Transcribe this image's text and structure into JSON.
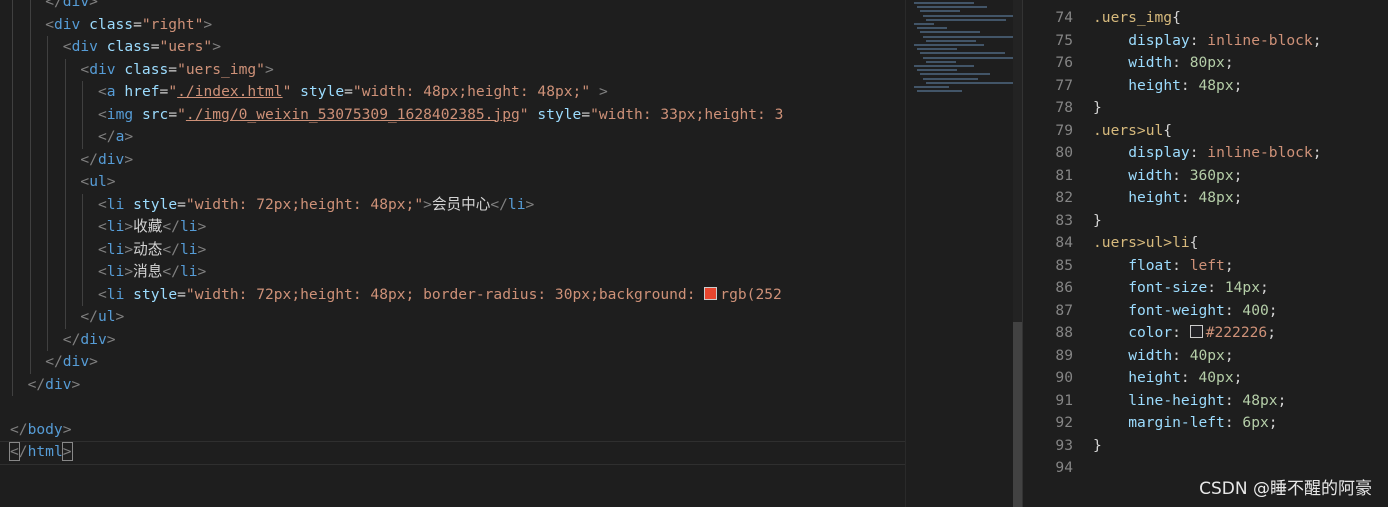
{
  "left_lines": [
    {
      "indent": 4,
      "tokens": [
        [
          "punct",
          "</"
        ],
        [
          "tag",
          "div"
        ],
        [
          "punct",
          ">"
        ]
      ]
    },
    {
      "indent": 4,
      "tokens": [
        [
          "punct",
          "<"
        ],
        [
          "tag",
          "div"
        ],
        [
          "txt",
          " "
        ],
        [
          "attr",
          "class"
        ],
        [
          "txt",
          "="
        ],
        [
          "str",
          "\"right\""
        ],
        [
          "punct",
          ">"
        ]
      ]
    },
    {
      "indent": 6,
      "tokens": [
        [
          "punct",
          "<"
        ],
        [
          "tag",
          "div"
        ],
        [
          "txt",
          " "
        ],
        [
          "attr",
          "class"
        ],
        [
          "txt",
          "="
        ],
        [
          "str",
          "\"uers\""
        ],
        [
          "punct",
          ">"
        ]
      ]
    },
    {
      "indent": 8,
      "tokens": [
        [
          "punct",
          "<"
        ],
        [
          "tag",
          "div"
        ],
        [
          "txt",
          " "
        ],
        [
          "attr",
          "class"
        ],
        [
          "txt",
          "="
        ],
        [
          "str",
          "\"uers_img\""
        ],
        [
          "punct",
          ">"
        ]
      ]
    },
    {
      "indent": 10,
      "tokens": [
        [
          "punct",
          "<"
        ],
        [
          "tag",
          "a"
        ],
        [
          "txt",
          " "
        ],
        [
          "attr",
          "href"
        ],
        [
          "txt",
          "="
        ],
        [
          "str",
          "\""
        ],
        [
          "link",
          "./index.html"
        ],
        [
          "str",
          "\""
        ],
        [
          "txt",
          " "
        ],
        [
          "attr",
          "style"
        ],
        [
          "txt",
          "="
        ],
        [
          "str",
          "\"width: 48px;height: 48px;\""
        ],
        [
          "txt",
          " "
        ],
        [
          "punct",
          ">"
        ]
      ]
    },
    {
      "indent": 10,
      "tokens": [
        [
          "punct",
          "<"
        ],
        [
          "tag",
          "img"
        ],
        [
          "txt",
          " "
        ],
        [
          "attr",
          "src"
        ],
        [
          "txt",
          "="
        ],
        [
          "str",
          "\""
        ],
        [
          "link",
          "./img/0_weixin_53075309_1628402385.jpg"
        ],
        [
          "str",
          "\""
        ],
        [
          "txt",
          " "
        ],
        [
          "attr",
          "style"
        ],
        [
          "txt",
          "="
        ],
        [
          "str",
          "\"width: 33px;height: 3"
        ]
      ]
    },
    {
      "indent": 10,
      "tokens": [
        [
          "punct",
          "</"
        ],
        [
          "tag",
          "a"
        ],
        [
          "punct",
          ">"
        ]
      ]
    },
    {
      "indent": 8,
      "tokens": [
        [
          "punct",
          "</"
        ],
        [
          "tag",
          "div"
        ],
        [
          "punct",
          ">"
        ]
      ]
    },
    {
      "indent": 8,
      "tokens": [
        [
          "punct",
          "<"
        ],
        [
          "tag",
          "ul"
        ],
        [
          "punct",
          ">"
        ]
      ]
    },
    {
      "indent": 10,
      "tokens": [
        [
          "punct",
          "<"
        ],
        [
          "tag",
          "li"
        ],
        [
          "txt",
          " "
        ],
        [
          "attr",
          "style"
        ],
        [
          "txt",
          "="
        ],
        [
          "str",
          "\"width: 72px;height: 48px;\""
        ],
        [
          "punct",
          ">"
        ],
        [
          "txt",
          "会员中心"
        ],
        [
          "punct",
          "</"
        ],
        [
          "tag",
          "li"
        ],
        [
          "punct",
          ">"
        ]
      ]
    },
    {
      "indent": 10,
      "tokens": [
        [
          "punct",
          "<"
        ],
        [
          "tag",
          "li"
        ],
        [
          "punct",
          ">"
        ],
        [
          "txt",
          "收藏"
        ],
        [
          "punct",
          "</"
        ],
        [
          "tag",
          "li"
        ],
        [
          "punct",
          ">"
        ]
      ]
    },
    {
      "indent": 10,
      "tokens": [
        [
          "punct",
          "<"
        ],
        [
          "tag",
          "li"
        ],
        [
          "punct",
          ">"
        ],
        [
          "txt",
          "动态"
        ],
        [
          "punct",
          "</"
        ],
        [
          "tag",
          "li"
        ],
        [
          "punct",
          ">"
        ]
      ]
    },
    {
      "indent": 10,
      "tokens": [
        [
          "punct",
          "<"
        ],
        [
          "tag",
          "li"
        ],
        [
          "punct",
          ">"
        ],
        [
          "txt",
          "消息"
        ],
        [
          "punct",
          "</"
        ],
        [
          "tag",
          "li"
        ],
        [
          "punct",
          ">"
        ]
      ]
    },
    {
      "indent": 10,
      "tokens": [
        [
          "punct",
          "<"
        ],
        [
          "tag",
          "li"
        ],
        [
          "txt",
          " "
        ],
        [
          "attr",
          "style"
        ],
        [
          "txt",
          "="
        ],
        [
          "str",
          "\"width: 72px;height: 48px; border-radius: 30px;background: "
        ],
        [
          "swatch",
          "#e8462f"
        ],
        [
          "str",
          "rgb(252"
        ]
      ]
    },
    {
      "indent": 8,
      "tokens": [
        [
          "punct",
          "</"
        ],
        [
          "tag",
          "ul"
        ],
        [
          "punct",
          ">"
        ]
      ]
    },
    {
      "indent": 6,
      "tokens": [
        [
          "punct",
          "</"
        ],
        [
          "tag",
          "div"
        ],
        [
          "punct",
          ">"
        ]
      ]
    },
    {
      "indent": 4,
      "tokens": [
        [
          "punct",
          "</"
        ],
        [
          "tag",
          "div"
        ],
        [
          "punct",
          ">"
        ]
      ]
    },
    {
      "indent": 2,
      "tokens": [
        [
          "punct",
          "</"
        ],
        [
          "tag",
          "div"
        ],
        [
          "punct",
          ">"
        ]
      ]
    },
    {
      "indent": 0,
      "tokens": []
    },
    {
      "indent": 0,
      "tokens": [
        [
          "punct",
          "</"
        ],
        [
          "tag",
          "body"
        ],
        [
          "punct",
          ">"
        ]
      ]
    },
    {
      "indent": 0,
      "tokens": [
        [
          "bracketl",
          "<"
        ],
        [
          "punct",
          "/"
        ],
        [
          "tag",
          "html"
        ],
        [
          "bracketr",
          ">"
        ]
      ]
    }
  ],
  "right_lines": [
    {
      "num": "74",
      "indent": 0,
      "tokens": [
        [
          "sel",
          ".uers_img"
        ],
        [
          "txt",
          "{"
        ]
      ]
    },
    {
      "num": "75",
      "indent": 4,
      "tokens": [
        [
          "prop",
          "display"
        ],
        [
          "txt",
          ": "
        ],
        [
          "val",
          "inline-block"
        ],
        [
          "txt",
          ";"
        ]
      ]
    },
    {
      "num": "76",
      "indent": 4,
      "tokens": [
        [
          "prop",
          "width"
        ],
        [
          "txt",
          ": "
        ],
        [
          "num",
          "80px"
        ],
        [
          "txt",
          ";"
        ]
      ]
    },
    {
      "num": "77",
      "indent": 4,
      "tokens": [
        [
          "prop",
          "height"
        ],
        [
          "txt",
          ": "
        ],
        [
          "num",
          "48px"
        ],
        [
          "txt",
          ";"
        ]
      ]
    },
    {
      "num": "78",
      "indent": 0,
      "tokens": [
        [
          "txt",
          "}"
        ]
      ]
    },
    {
      "num": "79",
      "indent": 0,
      "tokens": [
        [
          "sel",
          ".uers>ul"
        ],
        [
          "txt",
          "{"
        ]
      ]
    },
    {
      "num": "80",
      "indent": 4,
      "tokens": [
        [
          "prop",
          "display"
        ],
        [
          "txt",
          ": "
        ],
        [
          "val",
          "inline-block"
        ],
        [
          "txt",
          ";"
        ]
      ]
    },
    {
      "num": "81",
      "indent": 4,
      "tokens": [
        [
          "prop",
          "width"
        ],
        [
          "txt",
          ": "
        ],
        [
          "num",
          "360px"
        ],
        [
          "txt",
          ";"
        ]
      ]
    },
    {
      "num": "82",
      "indent": 4,
      "tokens": [
        [
          "prop",
          "height"
        ],
        [
          "txt",
          ": "
        ],
        [
          "num",
          "48px"
        ],
        [
          "txt",
          ";"
        ]
      ]
    },
    {
      "num": "83",
      "indent": 0,
      "tokens": [
        [
          "txt",
          "}"
        ]
      ]
    },
    {
      "num": "84",
      "indent": 0,
      "tokens": [
        [
          "sel",
          ".uers>ul>li"
        ],
        [
          "txt",
          "{"
        ]
      ]
    },
    {
      "num": "85",
      "indent": 4,
      "tokens": [
        [
          "prop",
          "float"
        ],
        [
          "txt",
          ": "
        ],
        [
          "val",
          "left"
        ],
        [
          "txt",
          ";"
        ]
      ]
    },
    {
      "num": "86",
      "indent": 4,
      "tokens": [
        [
          "prop",
          "font-size"
        ],
        [
          "txt",
          ": "
        ],
        [
          "num",
          "14px"
        ],
        [
          "txt",
          ";"
        ]
      ]
    },
    {
      "num": "87",
      "indent": 4,
      "tokens": [
        [
          "prop",
          "font-weight"
        ],
        [
          "txt",
          ": "
        ],
        [
          "num",
          "400"
        ],
        [
          "txt",
          ";"
        ]
      ]
    },
    {
      "num": "88",
      "indent": 4,
      "tokens": [
        [
          "prop",
          "color"
        ],
        [
          "txt",
          ": "
        ],
        [
          "swatch",
          "#222226"
        ],
        [
          "val",
          "#222226"
        ],
        [
          "txt",
          ";"
        ]
      ]
    },
    {
      "num": "89",
      "indent": 4,
      "tokens": [
        [
          "prop",
          "width"
        ],
        [
          "txt",
          ": "
        ],
        [
          "num",
          "40px"
        ],
        [
          "txt",
          ";"
        ]
      ]
    },
    {
      "num": "90",
      "indent": 4,
      "tokens": [
        [
          "prop",
          "height"
        ],
        [
          "txt",
          ": "
        ],
        [
          "num",
          "40px"
        ],
        [
          "txt",
          ";"
        ]
      ]
    },
    {
      "num": "91",
      "indent": 4,
      "tokens": [
        [
          "prop",
          "line-height"
        ],
        [
          "txt",
          ": "
        ],
        [
          "num",
          "48px"
        ],
        [
          "txt",
          ";"
        ]
      ]
    },
    {
      "num": "92",
      "indent": 4,
      "tokens": [
        [
          "prop",
          "margin-left"
        ],
        [
          "txt",
          ": "
        ],
        [
          "num",
          "6px"
        ],
        [
          "txt",
          ";"
        ]
      ]
    },
    {
      "num": "93",
      "indent": 0,
      "tokens": [
        [
          "txt",
          "}"
        ]
      ]
    },
    {
      "num": "94",
      "indent": 0,
      "tokens": []
    }
  ],
  "watermark": "CSDN @睡不醒的阿豪"
}
